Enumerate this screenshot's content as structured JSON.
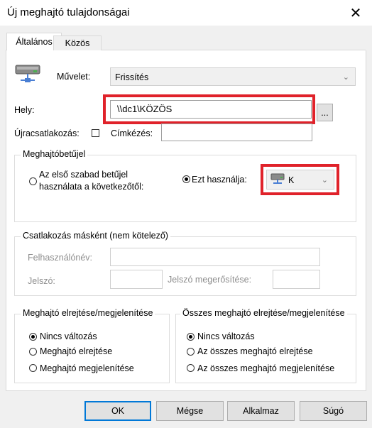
{
  "window": {
    "title": "Új meghajtó tulajdonságai",
    "close_glyph": "✕"
  },
  "tabs": [
    {
      "label": "Általános"
    },
    {
      "label": "Közös"
    }
  ],
  "action": {
    "label": "Művelet:",
    "value": "Frissítés"
  },
  "location": {
    "label": "Hely:",
    "value": "\\\\dc1\\KÖZÖS",
    "browse_label": "..."
  },
  "reconnect": {
    "label": "Újracsatlakozás:",
    "checked": false
  },
  "caption": {
    "label": "Címkézés:",
    "value": ""
  },
  "drive_letter": {
    "legend": "Meghajtóbetűjel",
    "first_available_label": "Az első szabad betűjel\nhasználata a következőtől:",
    "use_this_label": "Ezt használja:",
    "selected_letter": "K"
  },
  "connect_as": {
    "legend": "Csatlakozás másként (nem kötelező)",
    "username_label": "Felhasználónév:",
    "password_label": "Jelszó:",
    "confirm_label": "Jelszó megerősítése:"
  },
  "hide_show": {
    "legend": "Meghajtó elrejtése/megjelenítése",
    "options": [
      "Nincs változás",
      "Meghajtó elrejtése",
      "Meghajtó megjelenítése"
    ],
    "selected": 0
  },
  "hide_show_all": {
    "legend": "Összes meghajtó elrejtése/megjelenítése",
    "options": [
      "Nincs változás",
      "Az összes meghajtó elrejtése",
      "Az összes meghajtó megjelenítése"
    ],
    "selected": 0
  },
  "buttons": {
    "ok": "OK",
    "cancel": "Mégse",
    "apply": "Alkalmaz",
    "help": "Súgó"
  },
  "colors": {
    "highlight": "#e0222a",
    "accent": "#0078d7"
  }
}
